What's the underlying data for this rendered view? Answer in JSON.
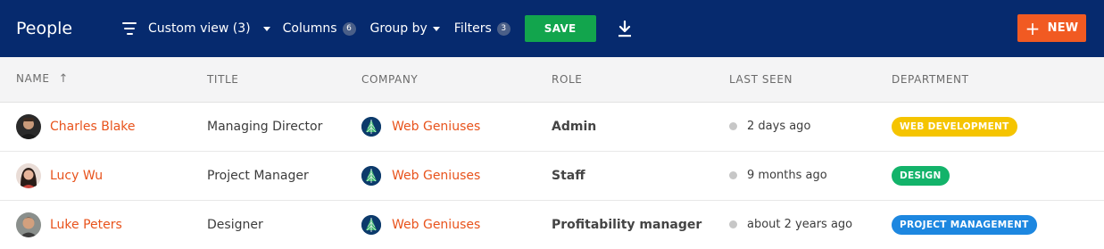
{
  "header": {
    "title": "People",
    "view_label": "Custom view (3)",
    "columns_label": "Columns",
    "columns_count": "6",
    "group_by_label": "Group by",
    "filters_label": "Filters",
    "filters_count": "3",
    "save_label": "SAVE",
    "new_label": "NEW"
  },
  "table": {
    "columns": [
      "NAME",
      "TITLE",
      "COMPANY",
      "ROLE",
      "LAST SEEN",
      "DEPARTMENT"
    ],
    "rows": [
      {
        "name": "Charles Blake",
        "title": "Managing Director",
        "company": "Web Geniuses",
        "role": "Admin",
        "last_seen": "2 days ago",
        "department": "WEB DEVELOPMENT"
      },
      {
        "name": "Lucy Wu",
        "title": "Project Manager",
        "company": "Web Geniuses",
        "role": "Staff",
        "last_seen": "9 months ago",
        "department": "DESIGN"
      },
      {
        "name": "Luke Peters",
        "title": "Designer",
        "company": "Web Geniuses",
        "role": "Profitability manager",
        "last_seen": "about 2 years ago",
        "department": "PROJECT MANAGEMENT"
      }
    ]
  },
  "colors": {
    "header_bg": "#062a6e",
    "save": "#12a54d",
    "new": "#f15a22",
    "link": "#e8531c",
    "web_development": "#f5c400",
    "design": "#13b36a",
    "project_management": "#1d87e0"
  }
}
